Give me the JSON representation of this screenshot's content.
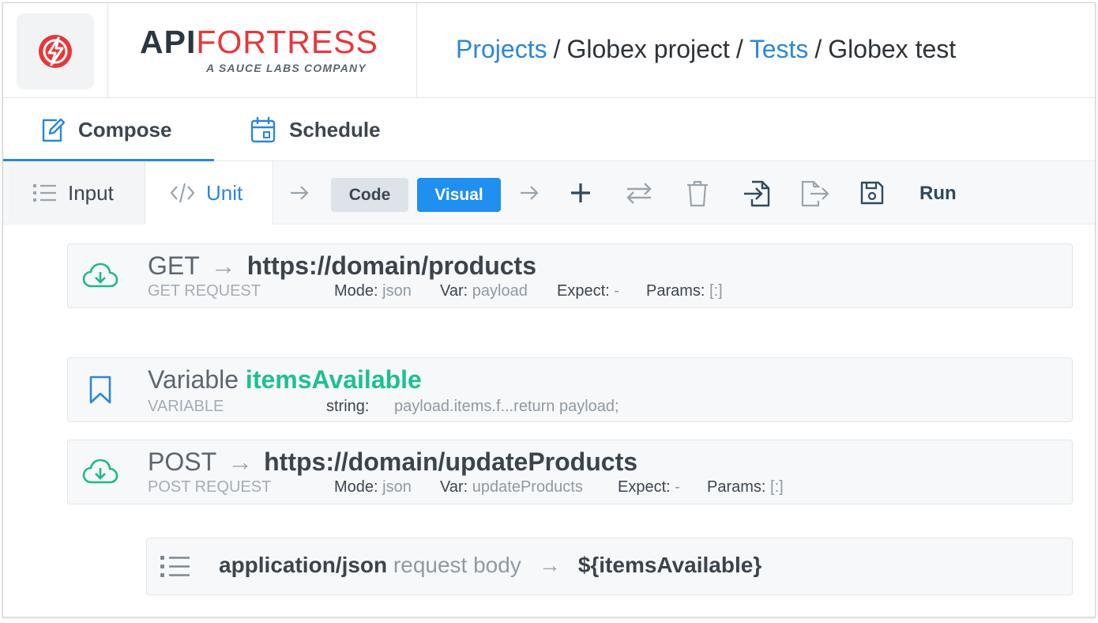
{
  "brand": {
    "name_bold": "API",
    "name_light": "FORTRESS",
    "tagline": "A SAUCE LABS COMPANY"
  },
  "breadcrumb": {
    "items": [
      {
        "label": "Projects",
        "link": true
      },
      {
        "label": "Globex project",
        "link": false
      },
      {
        "label": "Tests",
        "link": true
      },
      {
        "label": "Globex test",
        "link": false
      }
    ],
    "separator": "/"
  },
  "tabs": [
    {
      "label": "Compose",
      "icon": "pencil-square-icon",
      "active": true
    },
    {
      "label": "Schedule",
      "icon": "calendar-icon",
      "active": false
    }
  ],
  "toolbar": {
    "input_label": "Input",
    "unit_label": "Unit",
    "code_label": "Code",
    "visual_label": "Visual",
    "run_label": "Run",
    "icons": [
      "plus-icon",
      "swap-icon",
      "trash-icon",
      "import-icon",
      "export-icon",
      "save-icon"
    ]
  },
  "steps": [
    {
      "method": "GET",
      "url": "https://domain/products",
      "kind": "GET REQUEST",
      "mode_label": "Mode:",
      "mode": "json",
      "var_label": "Var:",
      "var": "payload",
      "expect_label": "Expect:",
      "expect": "-",
      "params_label": "Params:",
      "params": "[:]"
    },
    {
      "title": "Variable",
      "name": "itemsAvailable",
      "kind": "VARIABLE",
      "type_label": "string:",
      "value": "payload.items.f...return payload;"
    },
    {
      "method": "POST",
      "url": "https://domain/updateProducts",
      "kind": "POST REQUEST",
      "mode_label": "Mode:",
      "mode": "json",
      "var_label": "Var:",
      "var": "updateProducts",
      "expect_label": "Expect:",
      "expect": "-",
      "params_label": "Params:",
      "params": "[:]"
    }
  ],
  "request_body": {
    "content_type": "application/json",
    "label": "request body",
    "value": "${itemsAvailable}"
  },
  "colors": {
    "accent": "#2b87d8",
    "visual_button": "#1f8ff0",
    "brand_red": "#e8363a",
    "variable_green": "#1fbf93",
    "request_icon": "#20b78d"
  }
}
